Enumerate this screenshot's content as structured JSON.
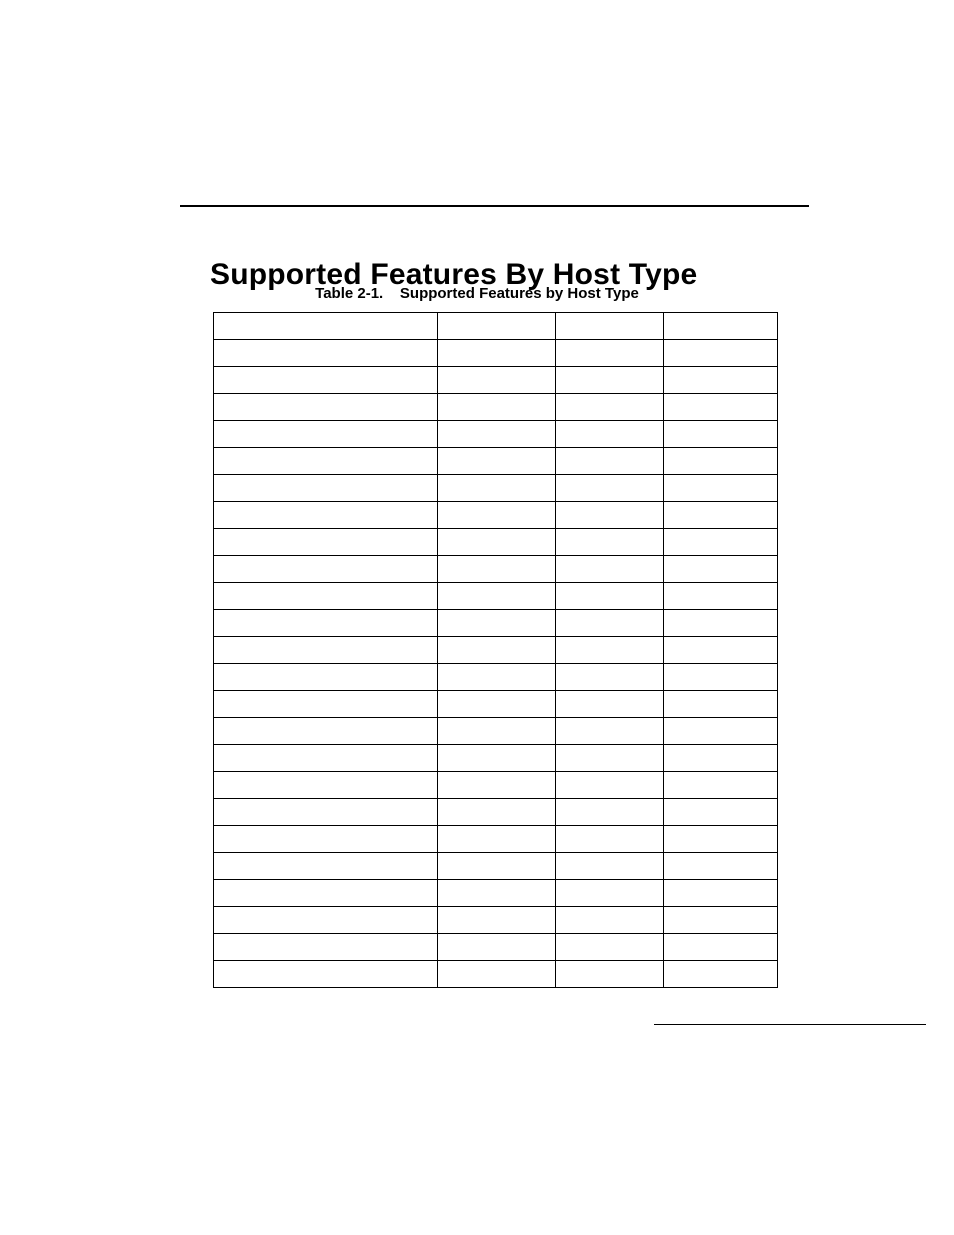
{
  "heading": "Supported Features By Host Type",
  "table": {
    "caption_prefix": "Table 2-1.",
    "caption_title": "Supported Features by Host Type",
    "row_count": 25,
    "columns": 4
  }
}
